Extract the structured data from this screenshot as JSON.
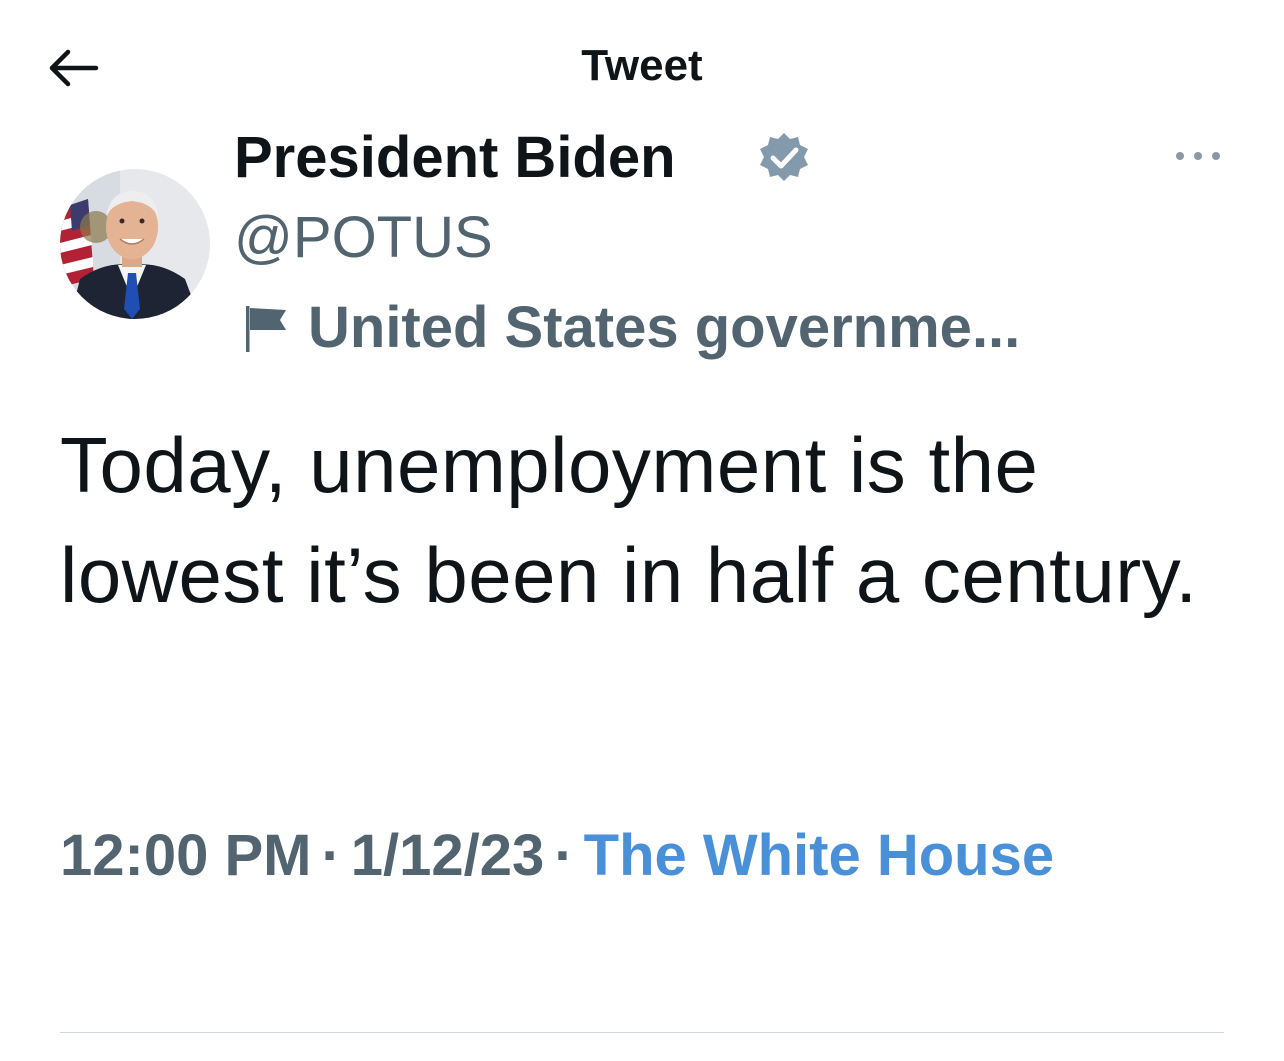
{
  "header": {
    "title": "Tweet",
    "back_icon": "arrow-left-icon"
  },
  "tweet": {
    "author": {
      "display_name": "President Biden",
      "handle": "@POTUS",
      "verified_badge_color": "#829aab",
      "gov_label": "United States governme..."
    },
    "text": "Today, unemployment is the lowest it’s been in half a century.",
    "time": "12:00 PM",
    "date": "1/12/23",
    "separator": "·",
    "source": "The White House"
  },
  "colors": {
    "text_primary": "#0f1419",
    "text_secondary": "#536471",
    "link": "#4a90d9",
    "divider": "#cfd9de"
  }
}
